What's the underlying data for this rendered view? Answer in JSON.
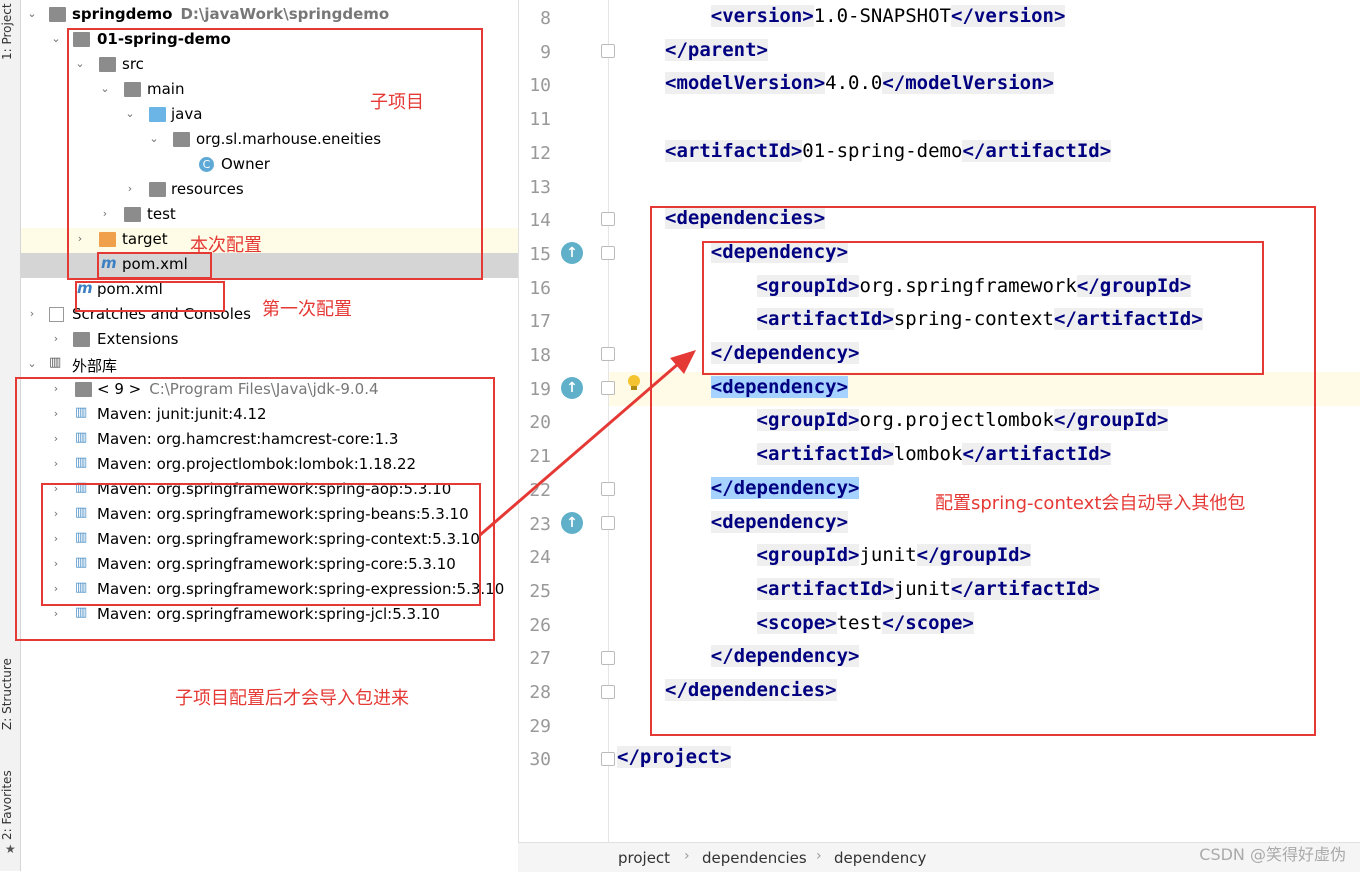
{
  "toolstrip": {
    "project_tab": "1: Project",
    "structure_tab": "Z: Structure",
    "favorites_tab": "2: Favorites"
  },
  "tree": {
    "root": {
      "label": "springdemo",
      "path": "D:\\javaWork\\springdemo"
    },
    "module": "01-spring-demo",
    "src": "src",
    "main": "main",
    "java": "java",
    "package": "org.sl.marhouse.eneities",
    "class": "Owner",
    "resources": "resources",
    "test": "test",
    "target": "target",
    "module_pom": "pom.xml",
    "root_pom": "pom.xml",
    "scratches": "Scratches and Consoles",
    "extensions": "Extensions",
    "external_libs": "外部库",
    "libs": [
      {
        "label": "< 9 >",
        "path": "C:\\Program Files\\Java\\jdk-9.0.4"
      },
      {
        "label": "Maven: junit:junit:4.12"
      },
      {
        "label": "Maven: org.hamcrest:hamcrest-core:1.3"
      },
      {
        "label": "Maven: org.projectlombok:lombok:1.18.22"
      },
      {
        "label": "Maven: org.springframework:spring-aop:5.3.10"
      },
      {
        "label": "Maven: org.springframework:spring-beans:5.3.10"
      },
      {
        "label": "Maven: org.springframework:spring-context:5.3.10"
      },
      {
        "label": "Maven: org.springframework:spring-core:5.3.10"
      },
      {
        "label": "Maven: org.springframework:spring-expression:5.3.10"
      },
      {
        "label": "Maven: org.springframework:spring-jcl:5.3.10"
      }
    ]
  },
  "editor": {
    "lines": [
      {
        "num": "8",
        "pre": "    ",
        "t1": "<version>",
        "txt": "1.0-SNAPSHOT",
        "t2": "</version>"
      },
      {
        "num": "9",
        "pre": "",
        "t1": "</parent>",
        "txt": "",
        "t2": ""
      },
      {
        "num": "10",
        "pre": "",
        "t1": "<modelVersion>",
        "txt": "4.0.0",
        "t2": "</modelVersion>"
      },
      {
        "num": "11",
        "pre": "",
        "t1": "",
        "txt": "",
        "t2": ""
      },
      {
        "num": "12",
        "pre": "",
        "t1": "<artifactId>",
        "txt": "01-spring-demo",
        "t2": "</artifactId>"
      },
      {
        "num": "13",
        "pre": "",
        "t1": "",
        "txt": "",
        "t2": ""
      },
      {
        "num": "14",
        "pre": "",
        "t1": "<dependencies>",
        "txt": "",
        "t2": ""
      },
      {
        "num": "15",
        "pre": "    ",
        "t1": "<dependency>",
        "txt": "",
        "t2": ""
      },
      {
        "num": "16",
        "pre": "        ",
        "t1": "<groupId>",
        "txt": "org.springframework",
        "t2": "</groupId>"
      },
      {
        "num": "17",
        "pre": "        ",
        "t1": "<artifactId>",
        "txt": "spring-context",
        "t2": "</artifactId>"
      },
      {
        "num": "18",
        "pre": "    ",
        "t1": "</dependency>",
        "txt": "",
        "t2": ""
      },
      {
        "num": "19",
        "pre": "    ",
        "t1": "<dependency>",
        "txt": "",
        "t2": ""
      },
      {
        "num": "20",
        "pre": "        ",
        "t1": "<groupId>",
        "txt": "org.projectlombok",
        "t2": "</groupId>"
      },
      {
        "num": "21",
        "pre": "        ",
        "t1": "<artifactId>",
        "txt": "lombok",
        "t2": "</artifactId>"
      },
      {
        "num": "22",
        "pre": "    ",
        "t1": "</dependency>",
        "txt": "",
        "t2": ""
      },
      {
        "num": "23",
        "pre": "    ",
        "t1": "<dependency>",
        "txt": "",
        "t2": ""
      },
      {
        "num": "24",
        "pre": "        ",
        "t1": "<groupId>",
        "txt": "junit",
        "t2": "</groupId>"
      },
      {
        "num": "25",
        "pre": "        ",
        "t1": "<artifactId>",
        "txt": "junit",
        "t2": "</artifactId>"
      },
      {
        "num": "26",
        "pre": "        ",
        "t1": "<scope>",
        "txt": "test",
        "t2": "</scope>"
      },
      {
        "num": "27",
        "pre": "    ",
        "t1": "</dependency>",
        "txt": "",
        "t2": ""
      },
      {
        "num": "28",
        "pre": "",
        "t1": "</dependencies>",
        "txt": "",
        "t2": ""
      },
      {
        "num": "29",
        "pre": "",
        "t1": "",
        "txt": "",
        "t2": ""
      },
      {
        "num": "30",
        "pre": "",
        "t1": "</project>",
        "txt": "",
        "t2": ""
      }
    ]
  },
  "breadcrumbs": [
    "project",
    "dependencies",
    "dependency"
  ],
  "annotations": {
    "subproject": "子项目",
    "this_config": "本次配置",
    "first_config": "第一次配置",
    "auto_import": "配置spring-context会自动导入其他包",
    "import_note": "子项目配置后才会导入包进来"
  },
  "watermark": "CSDN @笑得好虚伪",
  "colors": {
    "annotation": "#e53935",
    "tag": "#000080",
    "selection": "#a6d2ff"
  }
}
